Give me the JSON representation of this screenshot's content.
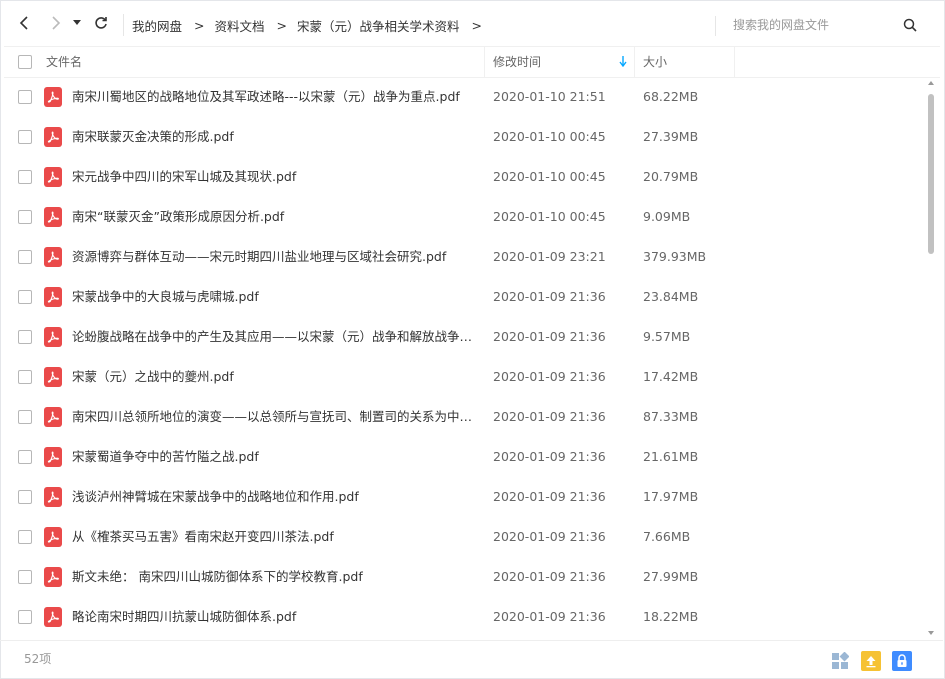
{
  "breadcrumb": [
    "我的网盘",
    "资料文档",
    "宋蒙（元）战争相关学术资料"
  ],
  "breadcrumb_separator": ">",
  "search": {
    "placeholder": "搜索我的网盘文件"
  },
  "columns": {
    "name": "文件名",
    "modified": "修改时间",
    "size": "大小"
  },
  "files": [
    {
      "name": "南宋川蜀地区的战略地位及其军政述略---以宋蒙（元）战争为重点.pdf",
      "modified": "2020-01-10 21:51",
      "size": "68.22MB"
    },
    {
      "name": "南宋联蒙灭金决策的形成.pdf",
      "modified": "2020-01-10 00:45",
      "size": "27.39MB"
    },
    {
      "name": "宋元战争中四川的宋军山城及其现状.pdf",
      "modified": "2020-01-10 00:45",
      "size": "20.79MB"
    },
    {
      "name": "南宋“联蒙灭金”政策形成原因分析.pdf",
      "modified": "2020-01-10 00:45",
      "size": "9.09MB"
    },
    {
      "name": "资源博弈与群体互动——宋元时期四川盐业地理与区域社会研究.pdf",
      "modified": "2020-01-09 23:21",
      "size": "379.93MB"
    },
    {
      "name": "宋蒙战争中的大良城与虎啸城.pdf",
      "modified": "2020-01-09 21:36",
      "size": "23.84MB"
    },
    {
      "name": "论蚡腹战略在战争中的产生及其应用——以宋蒙（元）战争和解放战争为例.pdf",
      "modified": "2020-01-09 21:36",
      "size": "9.57MB"
    },
    {
      "name": "宋蒙（元）之战中的夔州.pdf",
      "modified": "2020-01-09 21:36",
      "size": "17.42MB"
    },
    {
      "name": "南宋四川总领所地位的演变——以总领所与宣抚司、制置司的关系为中心.pdf",
      "modified": "2020-01-09 21:36",
      "size": "87.33MB"
    },
    {
      "name": "宋蒙蜀道争夺中的苦竹隘之战.pdf",
      "modified": "2020-01-09 21:36",
      "size": "21.61MB"
    },
    {
      "name": "浅谈泸州神臂城在宋蒙战争中的战略地位和作用.pdf",
      "modified": "2020-01-09 21:36",
      "size": "17.97MB"
    },
    {
      "name": "从《榷茶买马五害》看南宋赵开变四川茶法.pdf",
      "modified": "2020-01-09 21:36",
      "size": "7.66MB"
    },
    {
      "name": "斯文未绝： 南宋四川山城防御体系下的学校教育.pdf",
      "modified": "2020-01-09 21:36",
      "size": "27.99MB"
    },
    {
      "name": "略论南宋时期四川抗蒙山城防御体系.pdf",
      "modified": "2020-01-09 21:36",
      "size": "18.22MB"
    }
  ],
  "footer": {
    "count": "52项"
  },
  "colors": {
    "accent": "#06a7ff",
    "pdf": "#ea4a4a",
    "upload": "#f6c234",
    "lock": "#3f8cff"
  },
  "icons": [
    "back-icon",
    "forward-icon",
    "dropdown-caret-icon",
    "refresh-icon",
    "search-icon",
    "pdf-file-icon",
    "sort-desc-arrow-icon",
    "grid-view-icon",
    "upload-icon",
    "lock-icon"
  ]
}
